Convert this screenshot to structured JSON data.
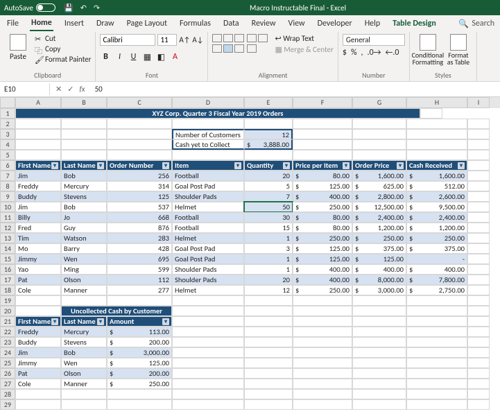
{
  "titlebar": {
    "autosave": "AutoSave",
    "title": "Macro Instructable Final - Excel"
  },
  "tabs": [
    "File",
    "Home",
    "Insert",
    "Draw",
    "Page Layout",
    "Formulas",
    "Data",
    "Review",
    "View",
    "Developer",
    "Help",
    "Table Design"
  ],
  "search": "Search",
  "clipboard": {
    "paste": "Paste",
    "cut": "Cut",
    "copy": "Copy",
    "fp": "Format Painter",
    "label": "Clipboard"
  },
  "font": {
    "name": "Calibri",
    "size": "11",
    "label": "Font"
  },
  "align": {
    "wrap": "Wrap Text",
    "merge": "Merge & Center",
    "label": "Alignment"
  },
  "number": {
    "sel": "General",
    "label": "Number"
  },
  "styles": {
    "cf": "Conditional Formatting",
    "fat": "Format as Table",
    "label": "Styles"
  },
  "namebox": "E10",
  "formula": "50",
  "cols": [
    "A",
    "B",
    "C",
    "D",
    "E",
    "F",
    "G",
    "H",
    "I"
  ],
  "title_row": "XYZ Corp. Quarter 3 Fiscal Year 2019 Orders",
  "summary": {
    "l1": "Number of Customers",
    "v1": "12",
    "l2": "Cash yet to Collect",
    "v2s": "$",
    "v2": "3,888.00"
  },
  "headers": [
    "First Name",
    "Last Name",
    "Order Number",
    "Item",
    "Quantity",
    "Price per Item",
    "Order Price",
    "Cash Received"
  ],
  "rows": [
    {
      "fn": "Jim",
      "ln": "Bob",
      "on": "256",
      "it": "Football",
      "q": "20",
      "pp": "80.00",
      "op": "1,600.00",
      "cr": "1,600.00"
    },
    {
      "fn": "Freddy",
      "ln": "Mercury",
      "on": "314",
      "it": "Goal Post Pad",
      "q": "5",
      "pp": "125.00",
      "op": "625.00",
      "cr": "512.00"
    },
    {
      "fn": "Buddy",
      "ln": "Stevens",
      "on": "125",
      "it": "Shoulder Pads",
      "q": "7",
      "pp": "400.00",
      "op": "2,800.00",
      "cr": "2,600.00"
    },
    {
      "fn": "Jim",
      "ln": "Bob",
      "on": "537",
      "it": "Helmet",
      "q": "50",
      "pp": "250.00",
      "op": "12,500.00",
      "cr": "9,500.00"
    },
    {
      "fn": "Billy",
      "ln": "Jo",
      "on": "668",
      "it": "Football",
      "q": "30",
      "pp": "80.00",
      "op": "2,400.00",
      "cr": "2,400.00"
    },
    {
      "fn": "Fred",
      "ln": "Guy",
      "on": "876",
      "it": "Football",
      "q": "15",
      "pp": "80.00",
      "op": "1,200.00",
      "cr": "1,200.00"
    },
    {
      "fn": "Tim",
      "ln": "Watson",
      "on": "283",
      "it": "Helmet",
      "q": "1",
      "pp": "250.00",
      "op": "250.00",
      "cr": "250.00"
    },
    {
      "fn": "Mo",
      "ln": "Barry",
      "on": "428",
      "it": "Goal Post Pad",
      "q": "3",
      "pp": "125.00",
      "op": "375.00",
      "cr": "375.00"
    },
    {
      "fn": "Jimmy",
      "ln": "Wen",
      "on": "695",
      "it": "Goal Post Pad",
      "q": "1",
      "pp": "125.00",
      "op": "125.00",
      "cr": "-"
    },
    {
      "fn": "Yao",
      "ln": "Ming",
      "on": "599",
      "it": "Shoulder Pads",
      "q": "1",
      "pp": "400.00",
      "op": "400.00",
      "cr": "400.00"
    },
    {
      "fn": "Pat",
      "ln": "Olson",
      "on": "112",
      "it": "Shoulder Pads",
      "q": "20",
      "pp": "400.00",
      "op": "8,000.00",
      "cr": "7,800.00"
    },
    {
      "fn": "Cole",
      "ln": "Manner",
      "on": "277",
      "it": "Helmet",
      "q": "12",
      "pp": "250.00",
      "op": "3,000.00",
      "cr": "2,750.00"
    }
  ],
  "uc_title": "Uncollected Cash by Customer",
  "uc_headers": [
    "First Name",
    "Last Name",
    "Amount"
  ],
  "uc_rows": [
    {
      "fn": "Freddy",
      "ln": "Mercury",
      "a": "113.00"
    },
    {
      "fn": "Buddy",
      "ln": "Stevens",
      "a": "200.00"
    },
    {
      "fn": "Jim",
      "ln": "Bob",
      "a": "3,000.00"
    },
    {
      "fn": "Jimmy",
      "ln": "Wen",
      "a": "125.00"
    },
    {
      "fn": "Pat",
      "ln": "Olson",
      "a": "200.00"
    },
    {
      "fn": "Cole",
      "ln": "Manner",
      "a": "250.00"
    }
  ]
}
